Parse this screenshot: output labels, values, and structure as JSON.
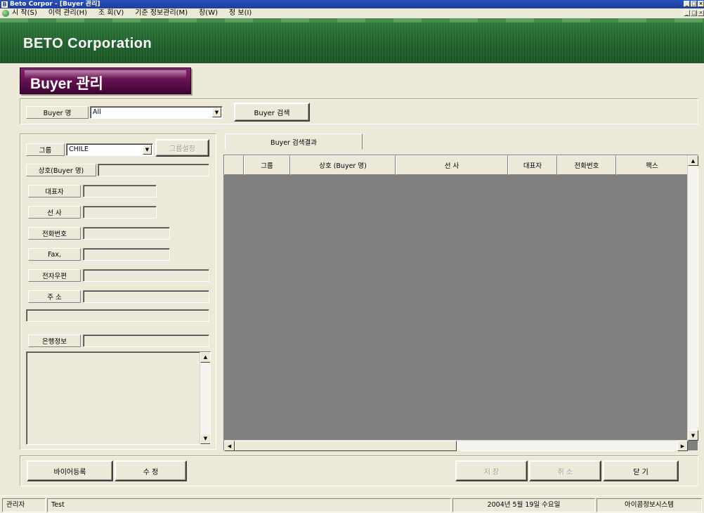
{
  "window": {
    "title": "Beto Corpor - [Buyer 관리]",
    "controls": [
      "_",
      "□",
      "×"
    ]
  },
  "menu": {
    "items": [
      "시 작(S)",
      "이력 관리(H)",
      "조 회(V)",
      "기준 정보관리(M)",
      "창(W)",
      "정 보(I)"
    ]
  },
  "banner": {
    "brand": "BETO Corporation",
    "brand_color": "#2f7a3d"
  },
  "page": {
    "title": "Buyer 관리",
    "title_color": "#6a1255"
  },
  "search": {
    "label": "Buyer 명",
    "value": "All",
    "button": "Buyer 검색"
  },
  "form": {
    "group_label": "그룹",
    "group_value": "CHILE",
    "group_button": "그룹설정",
    "company_label": "상호(Buyer 명)",
    "ceo_label": "대표자",
    "line_label": "선 사",
    "phone_label": "전화번호",
    "fax_label": "Fax,",
    "email_label": "전자우편",
    "address_label": "주 소",
    "bank_label": "은행정보"
  },
  "grid": {
    "tab": "Buyer 검색결과",
    "columns": [
      "",
      "그룹",
      "상호 (Buyer 명)",
      "선 사",
      "대표자",
      "전화번호",
      "팩스"
    ]
  },
  "actions": {
    "register": "바이어등록",
    "modify": "수 정",
    "save": "저 장",
    "cancel": "취 소",
    "close": "닫 기"
  },
  "status": {
    "role": "관리자",
    "user": "Test",
    "date": "2004년 5월 19일 수요일",
    "system": "아이콤정보시스템"
  }
}
